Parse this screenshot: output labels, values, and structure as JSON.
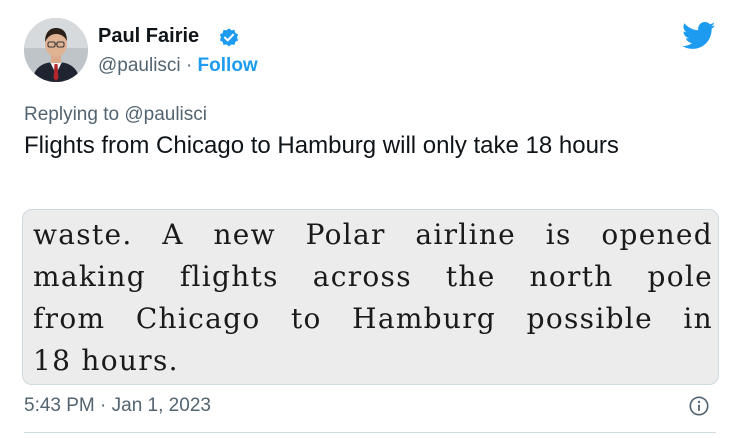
{
  "author": {
    "name": "Paul Fairie",
    "handle": "@paulisci",
    "separator": "·",
    "follow_label": "Follow"
  },
  "reply": {
    "prefix": "Replying to",
    "handle": "@paulisci"
  },
  "tweet": {
    "text": "Flights from Chicago to Hamburg will only take 18 hours"
  },
  "clipping": {
    "lines": [
      "waste.  A new Polar airline is opened",
      "making flights across the north pole",
      "from Chicago to Hamburg possible in",
      "18 hours."
    ]
  },
  "meta": {
    "timestamp": "5:43 PM · Jan 1, 2023"
  },
  "icons": {
    "verified": "verified-badge-icon",
    "twitter": "twitter-bird-icon",
    "info": "info-icon"
  },
  "colors": {
    "accent": "#1d9bf0",
    "text_primary": "#0f1419",
    "text_secondary": "#536471"
  }
}
